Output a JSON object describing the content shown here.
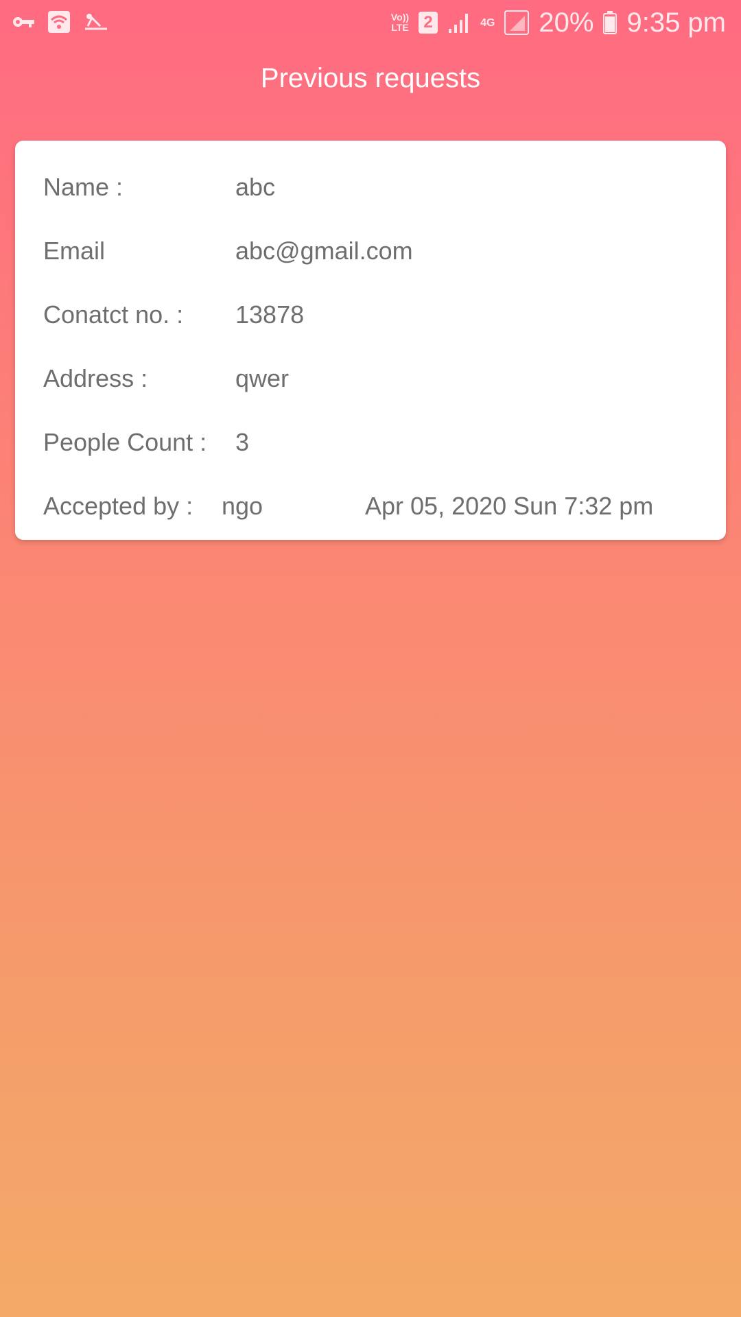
{
  "status_bar": {
    "left_icons": [
      "vpn-key-icon",
      "wifi-icon",
      "mode-icon"
    ],
    "volte_top": "Vo))",
    "volte_bottom": "LTE",
    "sim_number": "2",
    "network_type": "4G",
    "battery_percent": "20%",
    "time": "9:35 pm"
  },
  "header": {
    "title": "Previous requests"
  },
  "request": {
    "name_label": "Name :",
    "name_value": "abc",
    "email_label": "Email",
    "email_value": "abc@gmail.com",
    "contact_label": "Conatct no. :",
    "contact_value": "13878",
    "address_label": "Address :",
    "address_value": "qwer",
    "people_label": "People Count :",
    "people_value": "3",
    "accepted_label": "Accepted by :",
    "accepted_value": "ngo",
    "date": "Apr 05, 2020 Sun 7:32 pm"
  },
  "colors": {
    "gradient_top": "#ff6b82",
    "gradient_bottom": "#f3aa68",
    "card_text": "#6e6e6e"
  }
}
